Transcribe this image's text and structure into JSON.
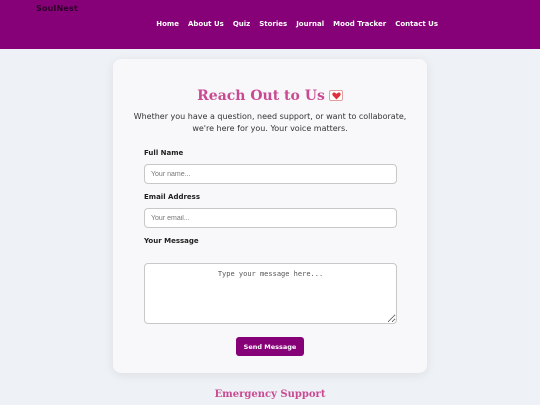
{
  "header": {
    "logo": "SoulNest",
    "nav": [
      {
        "label": "Home"
      },
      {
        "label": "About Us"
      },
      {
        "label": "Quiz"
      },
      {
        "label": "Stories"
      },
      {
        "label": "Journal"
      },
      {
        "label": "Mood Tracker"
      },
      {
        "label": "Contact Us"
      }
    ]
  },
  "contact": {
    "title": "Reach Out to Us",
    "title_icon": "love-letter-icon",
    "intro": "Whether you have a question, need support, or want to collaborate, we're here for you. Your voice matters.",
    "name_label": "Full Name",
    "name_placeholder": "Your name...",
    "email_label": "Email Address",
    "email_placeholder": "Your email...",
    "message_label": "Your Message",
    "message_placeholder": "Type your message here...",
    "send_label": "Send Message"
  },
  "emergency": {
    "title": "Emergency Support"
  },
  "colors": {
    "brand": "#860078",
    "accent_pink": "#c94a92",
    "background": "#eef1f5"
  }
}
